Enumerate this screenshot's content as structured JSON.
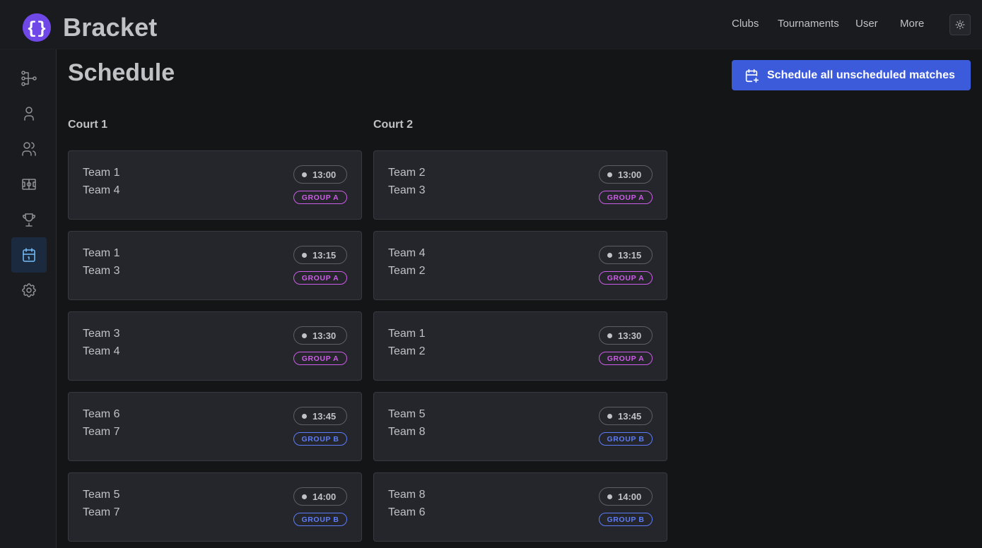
{
  "app": {
    "brand": "Bracket"
  },
  "topnav": [
    "Clubs",
    "Tournaments",
    "User",
    "More"
  ],
  "sidebar": {
    "items": [
      {
        "icon": "bracket-icon",
        "active": false
      },
      {
        "icon": "user-icon",
        "active": false
      },
      {
        "icon": "users-icon",
        "active": false
      },
      {
        "icon": "court-icon",
        "active": false
      },
      {
        "icon": "trophy-icon",
        "active": false
      },
      {
        "icon": "calendar-icon",
        "active": true
      },
      {
        "icon": "gear-icon",
        "active": false
      }
    ]
  },
  "page": {
    "title": "Schedule",
    "schedule_button": "Schedule all unscheduled matches"
  },
  "colors": {
    "accent": "#3b5bdb",
    "group_a": "#cc5de8",
    "group_b": "#5c7cfa"
  },
  "courts": [
    {
      "name": "Court 1",
      "matches": [
        {
          "team1": "Team 1",
          "team2": "Team 4",
          "time": "13:00",
          "group": "GROUP A"
        },
        {
          "team1": "Team 1",
          "team2": "Team 3",
          "time": "13:15",
          "group": "GROUP A"
        },
        {
          "team1": "Team 3",
          "team2": "Team 4",
          "time": "13:30",
          "group": "GROUP A"
        },
        {
          "team1": "Team 6",
          "team2": "Team 7",
          "time": "13:45",
          "group": "GROUP B"
        },
        {
          "team1": "Team 5",
          "team2": "Team 7",
          "time": "14:00",
          "group": "GROUP B"
        }
      ]
    },
    {
      "name": "Court 2",
      "matches": [
        {
          "team1": "Team 2",
          "team2": "Team 3",
          "time": "13:00",
          "group": "GROUP A"
        },
        {
          "team1": "Team 4",
          "team2": "Team 2",
          "time": "13:15",
          "group": "GROUP A"
        },
        {
          "team1": "Team 1",
          "team2": "Team 2",
          "time": "13:30",
          "group": "GROUP A"
        },
        {
          "team1": "Team 5",
          "team2": "Team 8",
          "time": "13:45",
          "group": "GROUP B"
        },
        {
          "team1": "Team 8",
          "team2": "Team 6",
          "time": "14:00",
          "group": "GROUP B"
        }
      ]
    }
  ]
}
